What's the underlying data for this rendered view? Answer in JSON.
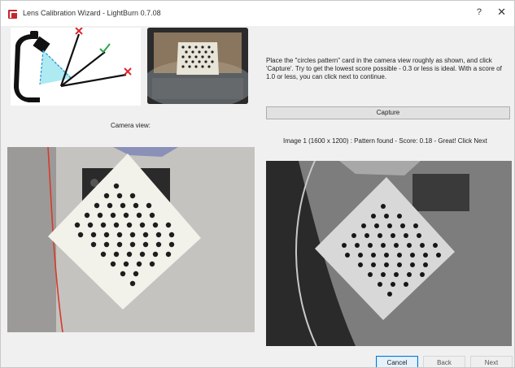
{
  "window": {
    "title": "Lens Calibration Wizard - LightBurn 0.7.08",
    "help_label": "?",
    "close_label": "✕"
  },
  "instructions": "Place the \"circles pattern\" card in the camera view roughly as shown, and click 'Capture'. Try to get the lowest score possible - 0.3 or less is ideal. With a score of 1.0 or less, you can click next to continue.",
  "capture_label": "Capture",
  "camera_label": "Camera view:",
  "status": "Image 1 (1600 x 1200) : Pattern found - Score: 0.18 - Great! Click Next",
  "buttons": {
    "cancel": "Cancel",
    "back": "Back",
    "next": "Next"
  },
  "icons": {
    "app": "lightburn-logo-icon",
    "help": "help-icon",
    "close": "close-icon"
  },
  "colors": {
    "app_icon": "#c4262e",
    "red_mark": "#e0262e",
    "green_mark": "#2ea44f",
    "camera_beam": "#9fe6f0",
    "focus_blue": "#0078d7"
  }
}
